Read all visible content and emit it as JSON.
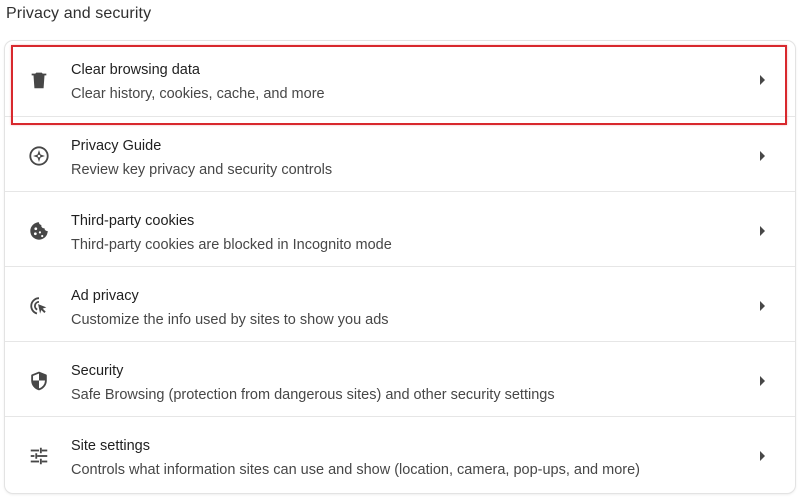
{
  "section_title": "Privacy and security",
  "items": [
    {
      "icon": "trash-icon",
      "label": "Clear browsing data",
      "sub": "Clear history, cookies, cache, and more"
    },
    {
      "icon": "compass-icon",
      "label": "Privacy Guide",
      "sub": "Review key privacy and security controls"
    },
    {
      "icon": "cookie-icon",
      "label": "Third-party cookies",
      "sub": "Third-party cookies are blocked in Incognito mode"
    },
    {
      "icon": "ad-privacy-icon",
      "label": "Ad privacy",
      "sub": "Customize the info used by sites to show you ads"
    },
    {
      "icon": "shield-icon",
      "label": "Security",
      "sub": "Safe Browsing (protection from dangerous sites) and other security settings"
    },
    {
      "icon": "tune-icon",
      "label": "Site settings",
      "sub": "Controls what information sites can use and show (location, camera, pop-ups, and more)"
    }
  ],
  "colors": {
    "highlight": "#d8282d",
    "icon": "#474747",
    "text_primary": "#1f1f1f",
    "text_secondary": "#474747"
  }
}
